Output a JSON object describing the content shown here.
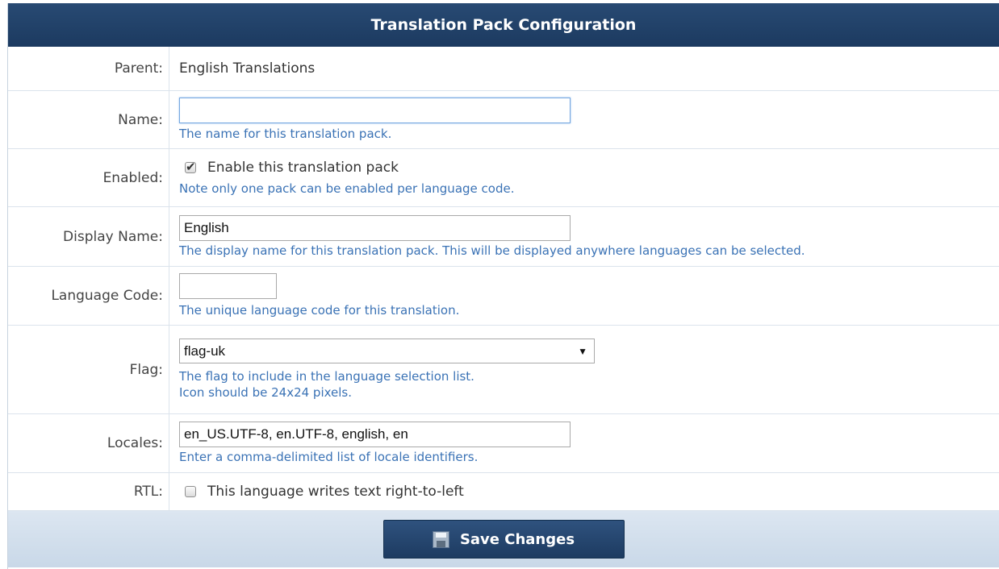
{
  "header": {
    "title": "Translation Pack Configuration"
  },
  "form": {
    "parent": {
      "label": "Parent:",
      "value": "English Translations"
    },
    "name": {
      "label": "Name:",
      "value": "",
      "hint": "The name for this translation pack."
    },
    "enabled": {
      "label": "Enabled:",
      "checked": true,
      "checkbox_label": "Enable this translation pack",
      "hint": "Note only one pack can be enabled per language code."
    },
    "display_name": {
      "label": "Display Name:",
      "value": "English",
      "hint": "The display name for this translation pack. This will be displayed anywhere languages can be selected."
    },
    "language_code": {
      "label": "Language Code:",
      "value": "",
      "hint": "The unique language code for this translation."
    },
    "flag": {
      "label": "Flag:",
      "selected": "flag-uk",
      "hint_line1": "The flag to include in the language selection list.",
      "hint_line2": "Icon should be 24x24 pixels."
    },
    "locales": {
      "label": "Locales:",
      "value": "en_US.UTF-8, en.UTF-8, english, en",
      "hint": "Enter a comma-delimited list of locale identifiers."
    },
    "rtl": {
      "label": "RTL:",
      "checked": false,
      "checkbox_label": "This language writes text right-to-left"
    }
  },
  "footer": {
    "save_label": "Save Changes"
  },
  "icons": {
    "save": "floppy-disk-icon",
    "dropdown": "triangle-down-icon",
    "check": "checkmark-icon"
  },
  "colors": {
    "header_bg": "#1f3e66",
    "hint_text": "#3a72b5",
    "footer_bg": "#d2dfec"
  }
}
